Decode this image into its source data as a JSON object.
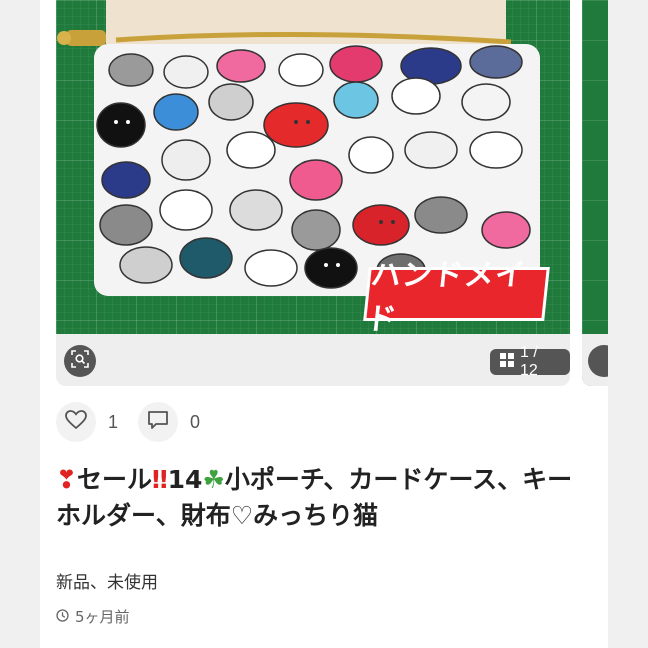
{
  "product": {
    "title": "セール14小ポーチ、カードケース、キーホルダー、財布♡みっちり猫",
    "title_parts": {
      "heart": "❣",
      "part1": "セール",
      "bang": "‼",
      "part2": "14",
      "clover": "☘",
      "part3": "小ポーチ、カードケース、キーホルダー、財布♡みっちり猫"
    },
    "condition": "新品、未使用",
    "posted_ago": "5ヶ月前"
  },
  "gallery": {
    "current": "1",
    "separator": "/",
    "total": "12",
    "stamp_text": "ハンドメイド",
    "zoom_icon": "zoom-scan-icon",
    "counter_icon": "grid-icon"
  },
  "actions": {
    "likes": {
      "icon": "heart-outline-icon",
      "count": "1"
    },
    "comments": {
      "icon": "comment-icon",
      "count": "0"
    }
  },
  "colors": {
    "accent_red": "#e8262c",
    "cutting_mat_green": "#1f7a3b",
    "badge_gray": "#555555"
  }
}
